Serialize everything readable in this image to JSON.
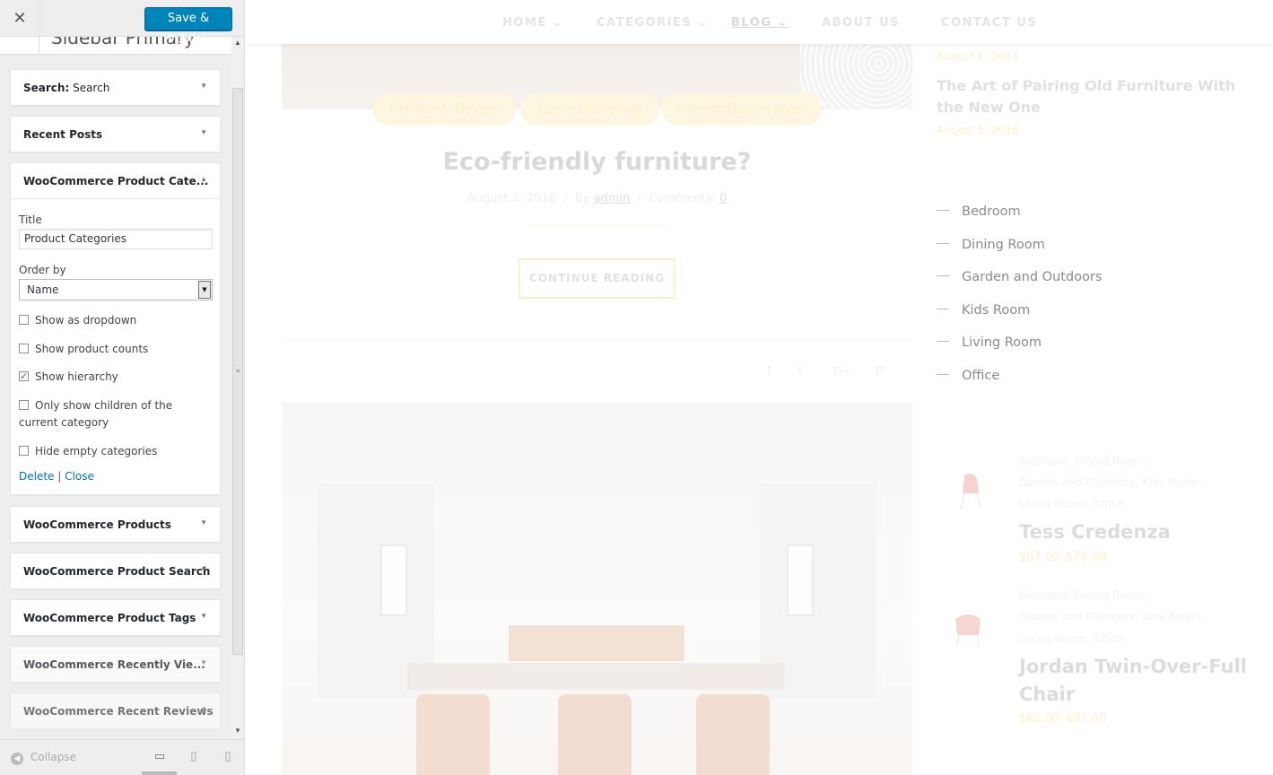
{
  "customizer": {
    "close_icon": "close-icon",
    "save_label": "Save & Publish",
    "section_title": "Sidebar Primary",
    "widgets": [
      {
        "title": "Search:",
        "subtitle": " Search"
      },
      {
        "title": "Recent Posts"
      },
      {
        "title": "WooCommerce Product Cate..."
      },
      {
        "title": "WooCommerce Products"
      },
      {
        "title": "WooCommerce Product Search"
      },
      {
        "title": "WooCommerce Product Tags"
      },
      {
        "title": "WooCommerce Recently Vie..."
      },
      {
        "title": "WooCommerce Recent Reviews"
      }
    ],
    "form": {
      "title_label": "Title",
      "title_value": "Product Categories",
      "orderby_label": "Order by",
      "orderby_value": "Name",
      "checkboxes": [
        {
          "label": "Show as dropdown",
          "checked": false
        },
        {
          "label": "Show product counts",
          "checked": false
        },
        {
          "label": "Show hierarchy",
          "checked": true
        },
        {
          "label": "Only show children of the current category",
          "checked": false
        },
        {
          "label": "Hide empty categories",
          "checked": false
        }
      ],
      "delete_label": "Delete",
      "separator": "|",
      "close_label": "Close"
    },
    "footer": {
      "collapse_label": "Collapse"
    }
  },
  "preview": {
    "nav": [
      "HOME",
      "CATEGORIES",
      "BLOG",
      "ABOUT US",
      "CONTACT US"
    ],
    "post": {
      "categories": [
        "Fashion & Design",
        "Home Designing",
        "Interior Design Ideas"
      ],
      "title": "Eco-friendly furniture?",
      "date": "August 3, 2016",
      "by": "By",
      "author": "admin",
      "comments_label": "Comments:",
      "comments_count": "0",
      "continue_label": "CONTINUE READING"
    },
    "sidebar": {
      "date_top": "August 6, 2016",
      "recent_post_title": "The Art of Pairing Old Furniture With the New One",
      "recent_post_date": "August 5, 2016",
      "categories": [
        "Bedroom",
        "Dining Room",
        "Garden and Outdoors",
        "Kids Room",
        "Living Room",
        "Office"
      ],
      "products": [
        {
          "cats": [
            "Bedroom, Dining Room,",
            "Garden and Outdoors, Kids Room,",
            "Living Room, Office"
          ],
          "name": "Tess Credenza",
          "price": "$67.00–$76.00"
        },
        {
          "cats": [
            "Bedroom, Dining Room,",
            "Garden and Outdoors, Kids Room,",
            "Living Room, Office"
          ],
          "name": "Jordan Twin-Over-Full Chair",
          "price": "$65.00–$87.00"
        }
      ]
    }
  },
  "colors": {
    "primary_button": "#0085ba",
    "link": "#0073aa",
    "accent_faded": "#fdf0c9"
  }
}
